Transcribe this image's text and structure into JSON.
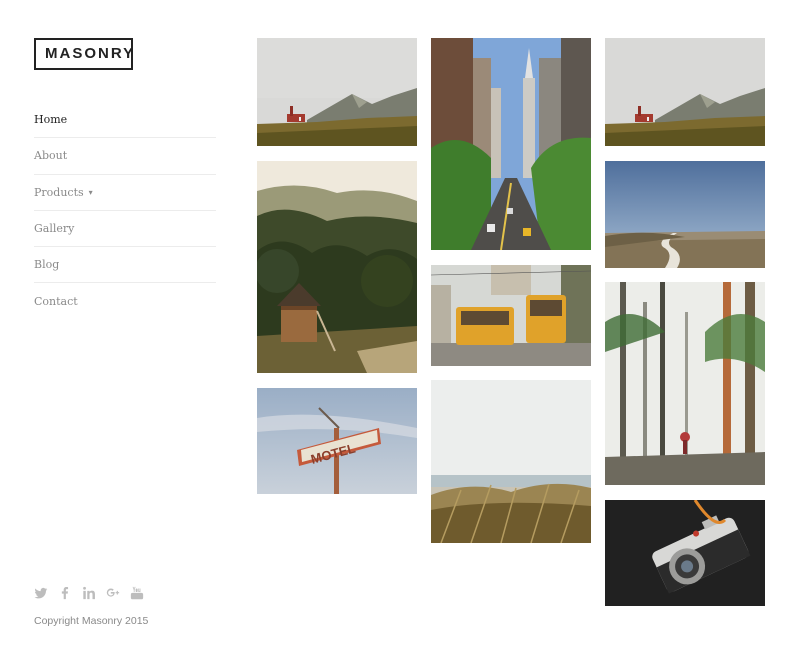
{
  "brand": {
    "logo": "MASONRY"
  },
  "nav": {
    "items": [
      {
        "label": "Home",
        "active": true
      },
      {
        "label": "About"
      },
      {
        "label": "Products",
        "has_dropdown": true
      },
      {
        "label": "Gallery"
      },
      {
        "label": "Blog"
      },
      {
        "label": "Contact"
      }
    ]
  },
  "social": {
    "icons": [
      "twitter-icon",
      "facebook-icon",
      "linkedin-icon",
      "google-plus-icon",
      "youtube-icon"
    ]
  },
  "footer": {
    "copyright": "Copyright Masonry 2015"
  },
  "gallery": {
    "photos": [
      "church-hills-photo",
      "forest-cabin-photo",
      "motel-sign-photo",
      "city-street-photo",
      "tram-photo",
      "beach-grass-photo",
      "church-hills-photo-2",
      "field-road-photo",
      "misty-forest-photo",
      "camera-photo"
    ]
  },
  "colors": {
    "text_active": "#222222",
    "text_muted": "#8a8a8a",
    "divider": "#ececec",
    "icon_muted": "#bdbdbd"
  }
}
